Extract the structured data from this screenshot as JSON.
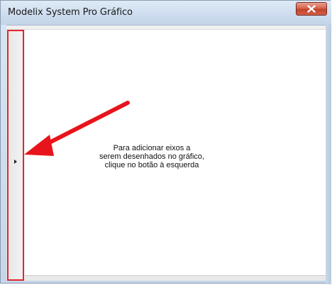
{
  "window": {
    "title": "Modelix System Pro Gráfico",
    "close_icon": "close-icon"
  },
  "chart_area": {
    "hint_lines": [
      "Para adicionar eixos a",
      "serem desenhados no gráfico,",
      "clique no botão à esquerda"
    ]
  },
  "left_panel": {
    "expand_icon": "triangle-right-icon"
  },
  "annotation": {
    "arrow_color": "#e8141b",
    "highlight_color": "#e3262b"
  }
}
